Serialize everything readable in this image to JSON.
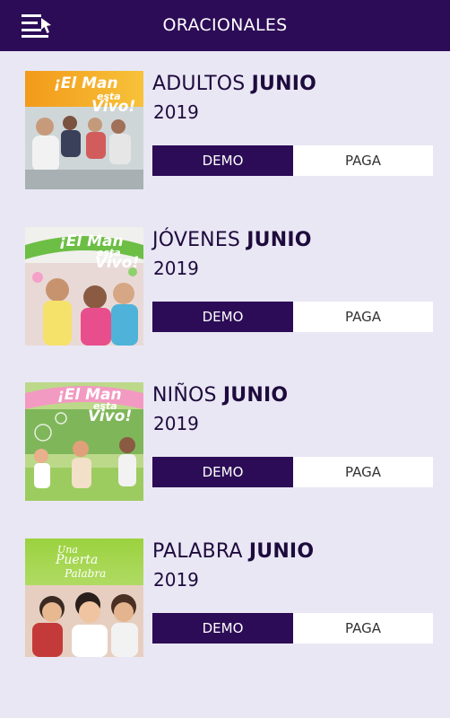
{
  "header": {
    "title": "ORACIONALES"
  },
  "items": [
    {
      "title_prefix": "ADULTOS",
      "title_month": "JUNIO",
      "year": "2019",
      "demo_label": "DEMO",
      "paga_label": "PAGA",
      "cover_text_1": "¡El Man",
      "cover_text_2": "esta",
      "cover_text_3": "Vivo!"
    },
    {
      "title_prefix": "JÓVENES",
      "title_month": "JUNIO",
      "year": "2019",
      "demo_label": "DEMO",
      "paga_label": "PAGA",
      "cover_text_1": "¡El Man",
      "cover_text_2": "esta",
      "cover_text_3": "Vivo!"
    },
    {
      "title_prefix": "NIÑOS",
      "title_month": "JUNIO",
      "year": "2019",
      "demo_label": "DEMO",
      "paga_label": "PAGA",
      "cover_text_1": "¡El Man",
      "cover_text_2": "esta",
      "cover_text_3": "Vivo!"
    },
    {
      "title_prefix": "PALABRA",
      "title_month": "JUNIO",
      "year": "2019",
      "demo_label": "DEMO",
      "paga_label": "PAGA",
      "cover_text_1": "Una",
      "cover_text_2": "Puerta",
      "cover_text_3": "Palabra"
    }
  ],
  "colors": {
    "header_bg": "#2c0c56",
    "page_bg": "#e9e7f4",
    "demo_bg": "#2c0c56",
    "paga_bg": "#ffffff"
  }
}
